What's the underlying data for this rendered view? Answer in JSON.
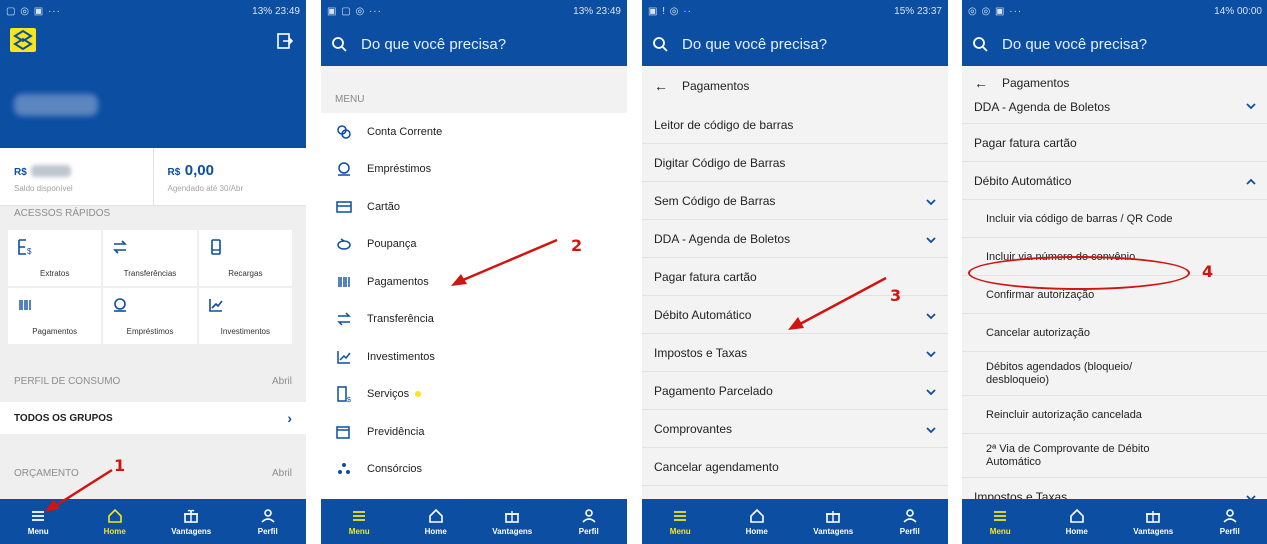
{
  "status_times": [
    "13% 23:49",
    "13% 23:49",
    "15% 23:37",
    "14% 00:00"
  ],
  "search_placeholder": "Do que você precisa?",
  "nav": {
    "menu": "Menu",
    "home": "Home",
    "vantagens": "Vantagens",
    "perfil": "Perfil"
  },
  "screen1": {
    "balance_left_cur": "R$",
    "balance_left_sub": "Saldo disponível",
    "balance_right_cur": "R$",
    "balance_right_val": "0,00",
    "balance_right_sub": "Agendado até 30/Abr",
    "quick_title": "ACESSOS RÁPIDOS",
    "quick": [
      "Extratos",
      "Transferências",
      "Recargas",
      "Pagamentos",
      "Empréstimos",
      "Investimentos"
    ],
    "perfil_consumo": "PERFIL DE CONSUMO",
    "perfil_month": "Abril",
    "todos_grupos": "TODOS OS GRUPOS",
    "orcamento": "ORÇAMENTO",
    "orcamento_month": "Abril",
    "annotation": "1"
  },
  "screen2": {
    "menu_head": "MENU",
    "items": [
      "Conta Corrente",
      "Empréstimos",
      "Cartão",
      "Poupança",
      "Pagamentos",
      "Transferência",
      "Investimentos",
      "Serviços",
      "Previdência",
      "Consórcios"
    ],
    "annotation": "2"
  },
  "screen3": {
    "back": "Pagamentos",
    "items": [
      "Leitor de código de barras",
      "Digitar Código de Barras",
      "Sem Código de Barras",
      "DDA - Agenda de Boletos",
      "Pagar fatura cartão",
      "Débito Automático",
      "Impostos e Taxas",
      "Pagamento Parcelado",
      "Comprovantes",
      "Cancelar agendamento"
    ],
    "annotation": "3"
  },
  "screen4": {
    "back": "Pagamentos",
    "items": [
      "DDA - Agenda de Boletos",
      "Pagar fatura cartão",
      "Débito Automático"
    ],
    "sub_items": [
      "Incluir via código de barras / QR Code",
      "Incluir via número do convênio",
      "Confirmar autorização",
      "Cancelar autorização",
      "Débitos agendados (bloqueio/ desbloqueio)",
      "Reincluir autorização cancelada",
      "2ª Via de Comprovante de Débito Automático"
    ],
    "last_item": "Impostos e Taxas",
    "annotation": "4"
  },
  "colors": {
    "brand_blue": "#0b4ea2",
    "brand_yellow": "#f8e61b",
    "annotation_red": "#d0140f"
  }
}
